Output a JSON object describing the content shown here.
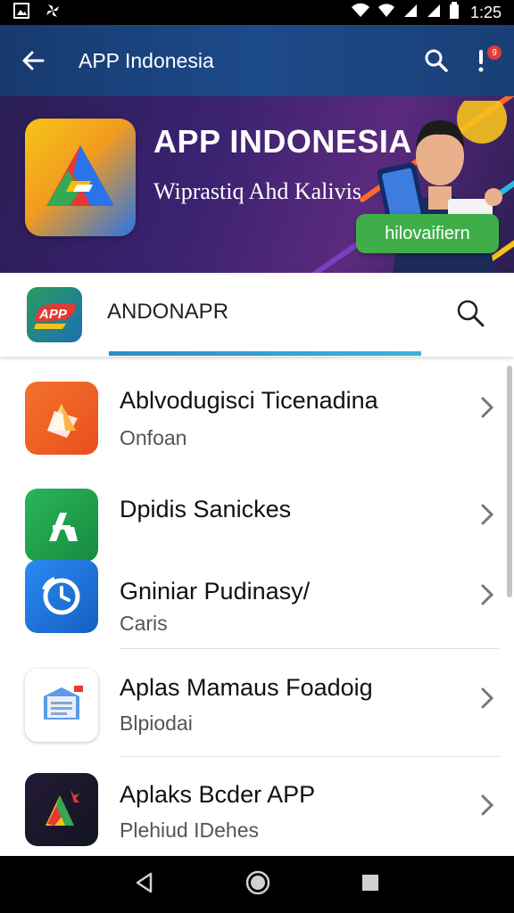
{
  "status_bar": {
    "time": "1:25"
  },
  "app_bar": {
    "title": "APP Indonesia",
    "notification_count": "9"
  },
  "banner": {
    "title": "APP INDONESIA",
    "subtitle": "Wiprastiq Ahd Kalivis",
    "button_label": "hilovaifiern"
  },
  "search_row": {
    "logo_text": "APP",
    "query": "ANDONAPR"
  },
  "apps": [
    {
      "title": "Ablvodugisci Ticenadina",
      "subtitle": "Onfoan",
      "icon": "document-app-icon",
      "color": "#f06a1c"
    },
    {
      "title": "Dpidis Sanickes",
      "subtitle": "",
      "icon": "letter-a-app-icon",
      "color": "#22a04a"
    },
    {
      "title": "Gniniar Pudinasy/",
      "subtitle": "Caris",
      "icon": "clock-app-icon",
      "color": "#1e74d8"
    },
    {
      "title": "Aplas Mamaus Foadoig",
      "subtitle": "Blpiodai",
      "icon": "inbox-app-icon",
      "color": "#ffffff"
    },
    {
      "title": "Aplaks Bcder APP",
      "subtitle": "Plehiud IDehes",
      "icon": "triangle-app-icon",
      "color": "#1f1f2e"
    }
  ]
}
